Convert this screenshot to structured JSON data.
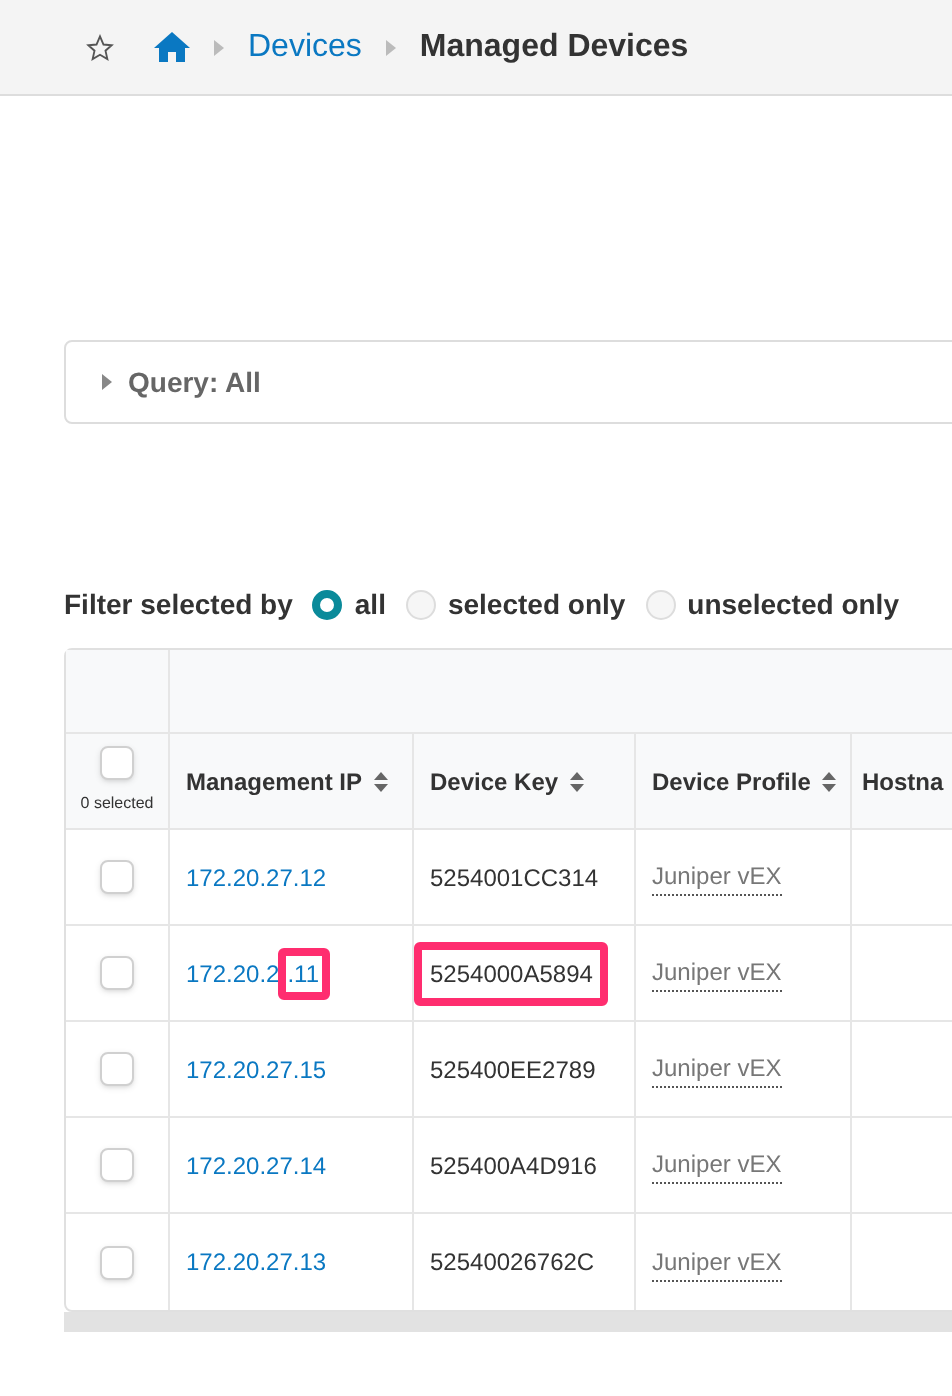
{
  "breadcrumb": {
    "items": [
      {
        "label": "Devices",
        "kind": "link"
      },
      {
        "label": "Managed Devices",
        "kind": "current"
      }
    ]
  },
  "query": {
    "label": "Query: All",
    "expanded": false
  },
  "filter": {
    "label": "Filter selected by",
    "options": [
      {
        "label": "all",
        "selected": true
      },
      {
        "label": "selected only",
        "selected": false
      },
      {
        "label": "unselected only",
        "selected": false
      }
    ]
  },
  "table": {
    "selected_count": "0 selected",
    "select_all_checked": false,
    "columns": [
      "Management IP",
      "Device Key",
      "Device Profile",
      "Hostna"
    ],
    "rows": [
      {
        "checked": false,
        "ip": "172.20.27.12",
        "ip_marked": "",
        "device_key": "5254001CC314",
        "key_marked": false,
        "device_profile": "Juniper vEX"
      },
      {
        "checked": false,
        "ip": "172.20.2",
        "ip_marked": ".11",
        "device_key": "5254000A5894",
        "key_marked": true,
        "device_profile": "Juniper vEX"
      },
      {
        "checked": false,
        "ip": "172.20.27.15",
        "ip_marked": "",
        "device_key": "525400EE2789",
        "key_marked": false,
        "device_profile": "Juniper vEX"
      },
      {
        "checked": false,
        "ip": "172.20.27.14",
        "ip_marked": "",
        "device_key": "525400A4D916",
        "key_marked": false,
        "device_profile": "Juniper vEX"
      },
      {
        "checked": false,
        "ip": "172.20.27.13",
        "ip_marked": "",
        "device_key": "52540026762C",
        "key_marked": false,
        "device_profile": "Juniper vEX"
      }
    ]
  }
}
